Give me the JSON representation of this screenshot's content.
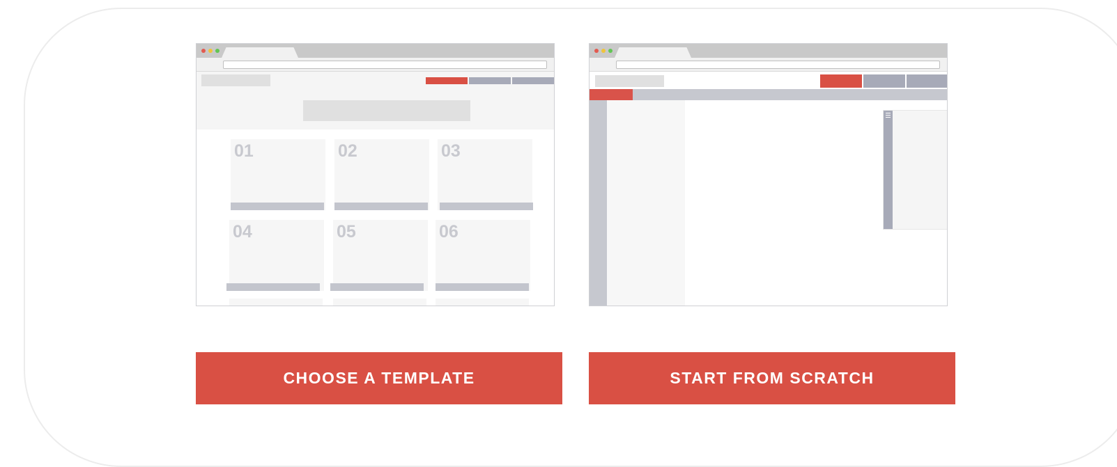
{
  "colors": {
    "accent": "#d95044",
    "nav_gray": "#a7aab8",
    "dot_red": "#e35b50",
    "dot_yellow": "#f0c43b",
    "dot_green": "#62c654"
  },
  "template_preview": {
    "cards": [
      "01",
      "02",
      "03",
      "04",
      "05",
      "06"
    ]
  },
  "scratch_preview": {
    "menu_icon": "hamburger-icon"
  },
  "actions": {
    "choose_template": "CHOOSE A TEMPLATE",
    "start_scratch": "START FROM SCRATCH"
  }
}
